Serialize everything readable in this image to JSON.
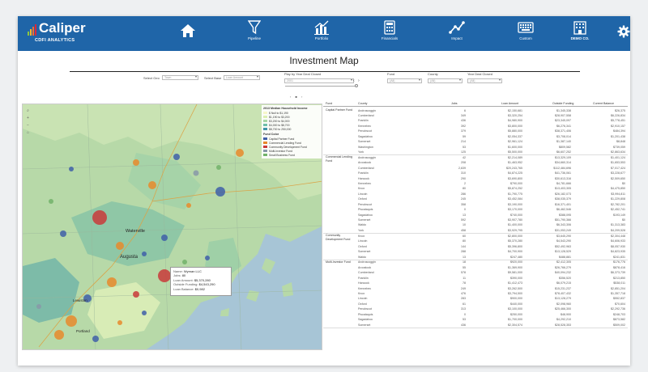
{
  "brand": {
    "name": "Caliper",
    "tagline": "CDFI ANALYTICS",
    "bar_colors": [
      "#8cc63f",
      "#f7b52c",
      "#ef6c2f",
      "#d7263d"
    ]
  },
  "nav": [
    {
      "label": "",
      "icon": "home-icon"
    },
    {
      "label": "Pipeline",
      "icon": "funnel-icon"
    },
    {
      "label": "Portfolio",
      "icon": "chart-bars-icon"
    },
    {
      "label": "Financials",
      "icon": "calculator-icon"
    },
    {
      "label": "Impact",
      "icon": "trend-icon"
    },
    {
      "label": "Custom",
      "icon": "keyboard-icon"
    },
    {
      "label": "DEMO CO.",
      "icon": "building-icon"
    },
    {
      "label": "",
      "icon": "gear-icon"
    }
  ],
  "page_title": "Investment Map",
  "filters": {
    "select_geo_label": "Select Geo",
    "select_geo_value": "Town",
    "select_base_label": "Select Base",
    "select_base_value": "Loan Amount",
    "play_label": "Play by Year Deal Closed",
    "play_value": "2001",
    "fund_label": "Fund",
    "fund_value": "(All)",
    "county_label": "County",
    "county_value": "(All)",
    "year_label": "Year Deal Closed",
    "year_value": "(All)"
  },
  "legend": {
    "income_title": "2013 Median Household Income",
    "income_items": [
      "$ Null to $1,190",
      "$1,190 to $3,200",
      "$3,200 to $4,000",
      "$4,000 to $8,700",
      "$8,700 to 250,000"
    ],
    "income_colors": [
      "#f6f7c9",
      "#dcefb2",
      "#a9d7a6",
      "#6fbfa9",
      "#3f95a8"
    ],
    "fund_title": "Fund Color",
    "fund_items": [
      "Capital Partner Fund",
      "Commercial Lending Fund",
      "Community Development Fund",
      "Multi-Investor Fund",
      "Small Business Fund"
    ],
    "fund_colors": [
      "#3f5fa8",
      "#e8892b",
      "#c93a3a",
      "#8898a8",
      "#72b26a"
    ]
  },
  "map_labels": [
    "Waterville",
    "Augusta",
    "Lewiston",
    "Portland"
  ],
  "tooltip": {
    "name_label": "Name:",
    "name": "Wyman LLC",
    "jobs_label": "Jobs:",
    "jobs": "80",
    "loan_label": "Loan Amount:",
    "loan": "$5,370,280",
    "outside_label": "Outside Funding:",
    "outside": "$4,543,290",
    "balance_label": "Loan Balance:",
    "balance": "$0,982"
  },
  "table": {
    "headers": [
      "Fund",
      "County",
      "Jobs",
      "Loan Amount",
      "Outside Funding",
      "Current Balance"
    ],
    "groups": [
      {
        "fund": "Capital Partner Fund",
        "rows": [
          [
            "Androscoggin",
            "6",
            "$2,150,681",
            "$1,345,338",
            "$26,375"
          ],
          [
            "Cumberland",
            "349",
            "$3,320,254",
            "$28,907,558",
            "$6,226,834"
          ],
          [
            "Franklin",
            "436",
            "$4,980,900",
            "$23,345,097",
            "$5,778,451"
          ],
          [
            "Kennebec",
            "392",
            "$3,800,000",
            "$6,276,341",
            "$2,910,157"
          ],
          [
            "Penobscot",
            "379",
            "$5,880,000",
            "$38,371,406",
            "$484,394"
          ],
          [
            "Sagadahoc",
            "59",
            "$2,054,337",
            "$3,708,014",
            "$1,201,438"
          ],
          [
            "Somerset",
            "214",
            "$2,961,124",
            "$1,387,140",
            "$8,848"
          ],
          [
            "Washington",
            "53",
            "$1,600,000",
            "$809,582",
            "$739,059"
          ],
          [
            "York",
            "125",
            "$5,500,000",
            "$6,607,252",
            "$2,863,634"
          ]
        ]
      },
      {
        "fund": "Commercial Lending Fund",
        "rows": [
          [
            "Androscoggin",
            "42",
            "$2,214,089",
            "$13,329,109",
            "$1,401,124"
          ],
          [
            "Aroostook",
            "208",
            "$1,463,952",
            "$34,660,314",
            "$1,653,553"
          ],
          [
            "Cumberland",
            "2,639",
            "$20,243,765",
            "$112,484,696",
            "$7,017,424"
          ],
          [
            "Franklin",
            "310",
            "$4,874,225",
            "$41,736,061",
            "$3,228,677"
          ],
          [
            "Hancock",
            "290",
            "$3,690,800",
            "$30,613,316",
            "$2,509,650"
          ],
          [
            "Kennebec",
            "2",
            "$790,000",
            "$4,781,666",
            "$0"
          ],
          [
            "Knox",
            "80",
            "$5,874,252",
            "$13,403,305",
            "$4,475,850"
          ],
          [
            "Lincoln",
            "286",
            "$1,790,775",
            "$26,182,073",
            "$3,994,811"
          ],
          [
            "Oxford",
            "245",
            "$3,452,084",
            "$38,035,379",
            "$1,229,808"
          ],
          [
            "Penobscot",
            "358",
            "$3,190,000",
            "$16,371,401",
            "$2,782,201"
          ],
          [
            "Piscataquis",
            "0",
            "$3,170,000",
            "$6,462,546",
            "$2,452,741"
          ],
          [
            "Sagadahoc",
            "13",
            "$740,000",
            "$388,095",
            "$193,149"
          ],
          [
            "Somerset",
            "592",
            "$3,907,780",
            "$51,790,366",
            "$0"
          ],
          [
            "Waldo",
            "10",
            "$1,400,000",
            "$6,343,306",
            "$1,313,383"
          ],
          [
            "York",
            "458",
            "$3,929,795",
            "$31,053,249",
            "$4,209,528"
          ]
        ]
      },
      {
        "fund": "Community Development Fund",
        "rows": [
          [
            "Knox",
            "60",
            "$2,800,000",
            "$3,645,290",
            "$2,304,448"
          ],
          [
            "Lincoln",
            "80",
            "$5,370,280",
            "$4,543,290",
            "$4,606,933"
          ],
          [
            "Oxford",
            "144",
            "$5,396,800",
            "$52,492,963",
            "$8,057,930"
          ],
          [
            "Somerset",
            "288",
            "$4,700,900",
            "$13,128,529",
            "$4,823,935"
          ],
          [
            "Waldo",
            "13",
            "$247,480",
            "$488,881",
            "$241,831"
          ]
        ]
      },
      {
        "fund": "Multi-Investor Fund",
        "rows": [
          [
            "Androscoggin",
            "18",
            "$920,000",
            "$2,412,305",
            "$176,776"
          ],
          [
            "Aroostook",
            "55",
            "$1,369,900",
            "$26,766,279",
            "$878,416"
          ],
          [
            "Cumberland",
            "578",
            "$9,581,000",
            "$40,094,232",
            "$6,373,739"
          ],
          [
            "Franklin",
            "11",
            "$390,000",
            "$356,520",
            "$213,850"
          ],
          [
            "Hancock",
            "78",
            "$1,412,473",
            "$6,079,215",
            "$538,011"
          ],
          [
            "Kennebec",
            "249",
            "$3,262,500",
            "$15,231,237",
            "$2,851,204"
          ],
          [
            "Knox",
            "476",
            "$3,794,500",
            "$78,407,432",
            "$1,357,718"
          ],
          [
            "Lincoln",
            "283",
            "$900,000",
            "$13,128,279",
            "$552,837"
          ],
          [
            "Oxford",
            "61",
            "$440,000",
            "$2,098,960",
            "$70,604"
          ],
          [
            "Penobscot",
            "313",
            "$3,100,000",
            "$25,466,300",
            "$2,292,736"
          ],
          [
            "Piscataquis",
            "0",
            "$250,000",
            "$48,900",
            "$248,703"
          ],
          [
            "Sagadahoc",
            "53",
            "$1,700,000",
            "$4,292,210",
            "$873,582"
          ],
          [
            "Somerset",
            "436",
            "$2,304,574",
            "$28,528,353",
            "$509,002"
          ]
        ]
      }
    ]
  }
}
